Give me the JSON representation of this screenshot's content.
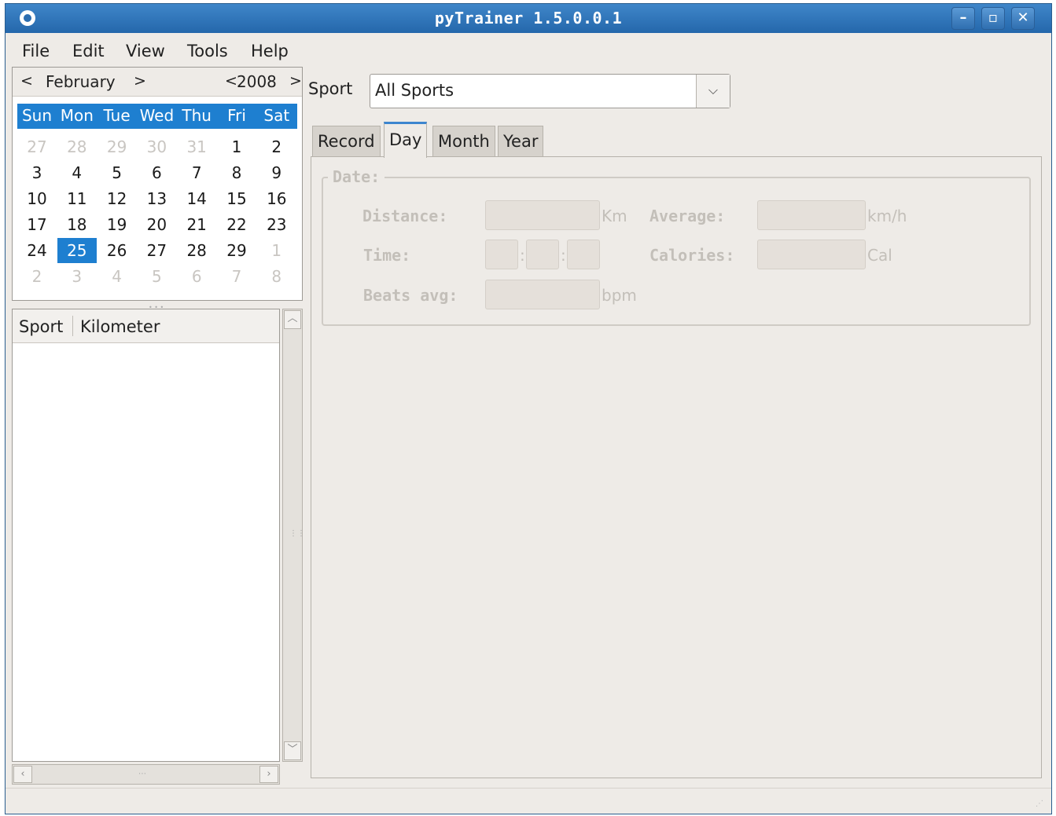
{
  "window": {
    "title": "pyTrainer 1.5.0.0.1",
    "min": "–",
    "max": "▫",
    "close": "✕"
  },
  "menu": [
    "File",
    "Edit",
    "View",
    "Tools",
    "Help"
  ],
  "calendar": {
    "month": "February",
    "year": "2008",
    "prev": "<",
    "next": ">",
    "day_names": [
      "Sun",
      "Mon",
      "Tue",
      "Wed",
      "Thu",
      "Fri",
      "Sat"
    ],
    "weeks": [
      [
        "27",
        "28",
        "29",
        "30",
        "31",
        "1",
        "2"
      ],
      [
        "3",
        "4",
        "5",
        "6",
        "7",
        "8",
        "9"
      ],
      [
        "10",
        "11",
        "12",
        "13",
        "14",
        "15",
        "16"
      ],
      [
        "17",
        "18",
        "19",
        "20",
        "21",
        "22",
        "23"
      ],
      [
        "24",
        "25",
        "26",
        "27",
        "28",
        "29",
        "1"
      ],
      [
        "2",
        "3",
        "4",
        "5",
        "6",
        "7",
        "8"
      ]
    ],
    "other_month": [
      [
        true,
        true,
        true,
        true,
        true,
        false,
        false
      ],
      [
        false,
        false,
        false,
        false,
        false,
        false,
        false
      ],
      [
        false,
        false,
        false,
        false,
        false,
        false,
        false
      ],
      [
        false,
        false,
        false,
        false,
        false,
        false,
        false
      ],
      [
        false,
        false,
        false,
        false,
        false,
        false,
        true
      ],
      [
        true,
        true,
        true,
        true,
        true,
        true,
        true
      ]
    ],
    "selected": "25"
  },
  "list": {
    "columns": [
      "Sport",
      "Kilometer"
    ]
  },
  "sport": {
    "label": "Sport",
    "value": "All Sports"
  },
  "tabs": [
    "Record",
    "Day",
    "Month",
    "Year"
  ],
  "active_tab": "Day",
  "day": {
    "frame_label": "Date:",
    "distance_label": "Distance:",
    "distance_unit": "Km",
    "average_label": "Average:",
    "average_unit": "km/h",
    "time_label": "Time:",
    "calories_label": "Calories:",
    "calories_unit": "Cal",
    "beats_label": "Beats avg:",
    "beats_unit": "bpm"
  }
}
